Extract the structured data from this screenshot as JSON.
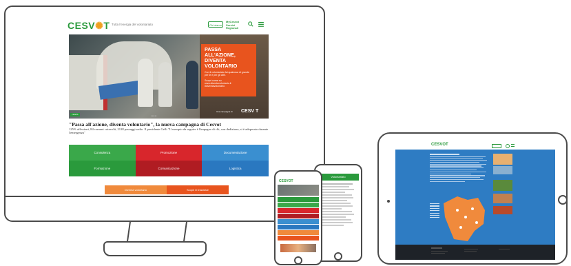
{
  "desktop": {
    "header": {
      "logo_text": "CESV",
      "logo_text_end": "T",
      "tagline": "Tutta l'energia del volontariato",
      "button_1": "Chi siamo",
      "button_2": "MyCesvot Servizi Regionali"
    },
    "hero": {
      "card_title": "PASSA ALL'AZIONE, DIVENTA VOLONTARIO",
      "card_text": "Con il volontariato fai qualcosa di grande per te e per gli altri.",
      "card_link_intro": "Scopri come su",
      "card_link": "www.diventavolontario.it",
      "card_hashtag": "#diventavolontario",
      "brand": "CESV T",
      "brand_tag": "Una campagna di",
      "badge": "NEWS"
    },
    "news": {
      "title": "\"Passa all'azione, diventa volontario\", la nuova campagna di Cesvot",
      "subtitle": "125% affissioni, 84 comuni coinvolti, 2128 passaggi radio. Il presidente Gelli \"L'esempio da seguire è l'impegno di chi, con dedizione, si è adoperato durante l'emergenza\""
    },
    "tiles": [
      {
        "label": "Consulenza",
        "color": "#3aa84a"
      },
      {
        "label": "Promozione",
        "color": "#d8262c"
      },
      {
        "label": "Documentazione",
        "color": "#3a8fd0"
      },
      {
        "label": "Formazione",
        "color": "#2a9a3c"
      },
      {
        "label": "Comunicazione",
        "color": "#b01c22"
      },
      {
        "label": "Logistica",
        "color": "#2a78c0"
      }
    ],
    "cta": [
      {
        "label": "Diventa volontario",
        "color": "#f08a3c"
      },
      {
        "label": "Scopri le iniziative",
        "color": "#e8541e"
      }
    ]
  },
  "phone_left": {
    "logo": "CESVOT",
    "bars": [
      {
        "label": "",
        "color": "#2a9a3c"
      },
      {
        "label": "",
        "color": "#3aa84a"
      },
      {
        "label": "",
        "color": "#d8262c"
      },
      {
        "label": "",
        "color": "#b01c22"
      },
      {
        "label": "",
        "color": "#3a8fd0"
      },
      {
        "label": "",
        "color": "#2a78c0"
      },
      {
        "label": "",
        "color": "#f08a3c"
      },
      {
        "label": "",
        "color": "#e8541e"
      }
    ]
  },
  "phone_right": {
    "header": "Volontariato"
  },
  "tablet": {
    "logo": "CESVOT"
  },
  "colors": {
    "brand_green": "#2a9a3c",
    "brand_orange": "#e8541e",
    "tablet_blue": "#2e7cc3",
    "device_stroke": "#4a4a4a"
  }
}
